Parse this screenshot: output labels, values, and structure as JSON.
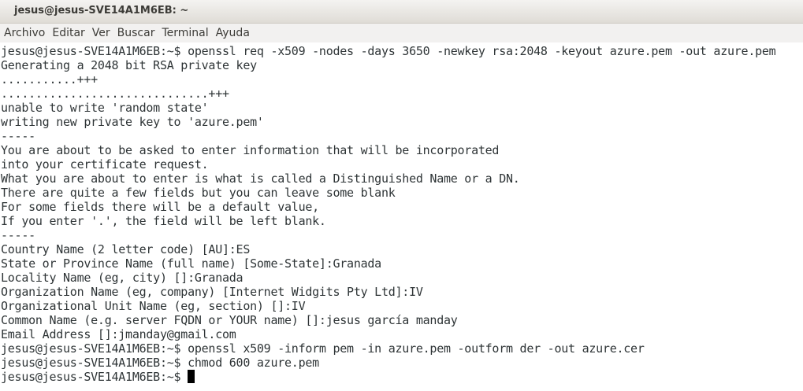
{
  "window": {
    "title": "jesus@jesus-SVE14A1M6EB: ~"
  },
  "menu": {
    "items": [
      "Archivo",
      "Editar",
      "Ver",
      "Buscar",
      "Terminal",
      "Ayuda"
    ]
  },
  "terminal": {
    "lines": [
      "jesus@jesus-SVE14A1M6EB:~$ openssl req -x509 -nodes -days 3650 -newkey rsa:2048 -keyout azure.pem -out azure.pem",
      "Generating a 2048 bit RSA private key",
      "...........+++",
      "..............................+++",
      "unable to write 'random state'",
      "writing new private key to 'azure.pem'",
      "-----",
      "You are about to be asked to enter information that will be incorporated",
      "into your certificate request.",
      "What you are about to enter is what is called a Distinguished Name or a DN.",
      "There are quite a few fields but you can leave some blank",
      "For some fields there will be a default value,",
      "If you enter '.', the field will be left blank.",
      "-----",
      "Country Name (2 letter code) [AU]:ES",
      "State or Province Name (full name) [Some-State]:Granada",
      "Locality Name (eg, city) []:Granada",
      "Organization Name (eg, company) [Internet Widgits Pty Ltd]:IV",
      "Organizational Unit Name (eg, section) []:IV",
      "Common Name (e.g. server FQDN or YOUR name) []:jesus garcía manday",
      "Email Address []:jmanday@gmail.com",
      "jesus@jesus-SVE14A1M6EB:~$ openssl x509 -inform pem -in azure.pem -outform der -out azure.cer",
      "jesus@jesus-SVE14A1M6EB:~$ chmod 600 azure.pem"
    ],
    "prompt": "jesus@jesus-SVE14A1M6EB:~$"
  }
}
